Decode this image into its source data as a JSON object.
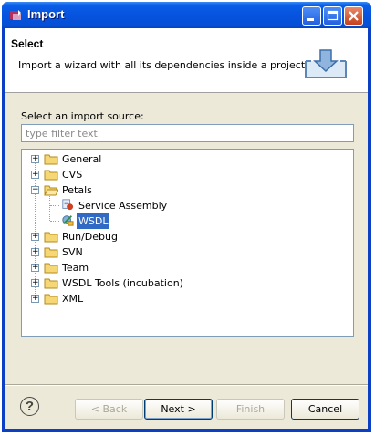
{
  "window": {
    "title": "Import"
  },
  "header": {
    "title": "Select",
    "description": "Import a wizard with all its dependencies inside a project"
  },
  "source": {
    "label": "Select an import source:",
    "filter_placeholder": "type filter text"
  },
  "tree": {
    "items": [
      {
        "label": "General",
        "expanded": false,
        "icon": "folder-icon"
      },
      {
        "label": "CVS",
        "expanded": false,
        "icon": "folder-icon"
      },
      {
        "label": "Petals",
        "expanded": true,
        "icon": "folder-open-icon"
      },
      {
        "label": "Service Assembly",
        "icon": "service-assembly-icon"
      },
      {
        "label": "WSDL",
        "icon": "wsdl-icon",
        "selected": true
      },
      {
        "label": "Run/Debug",
        "expanded": false,
        "icon": "folder-icon"
      },
      {
        "label": "SVN",
        "expanded": false,
        "icon": "folder-icon"
      },
      {
        "label": "Team",
        "expanded": false,
        "icon": "folder-icon"
      },
      {
        "label": "WSDL Tools (incubation)",
        "expanded": false,
        "icon": "folder-icon"
      },
      {
        "label": "XML",
        "expanded": false,
        "icon": "folder-icon"
      }
    ]
  },
  "buttons": {
    "back": "< Back",
    "next": "Next >",
    "finish": "Finish",
    "cancel": "Cancel"
  },
  "colors": {
    "titlebar": "#0653de",
    "selection": "#316ac5",
    "dialog_bg": "#ece9d8"
  }
}
